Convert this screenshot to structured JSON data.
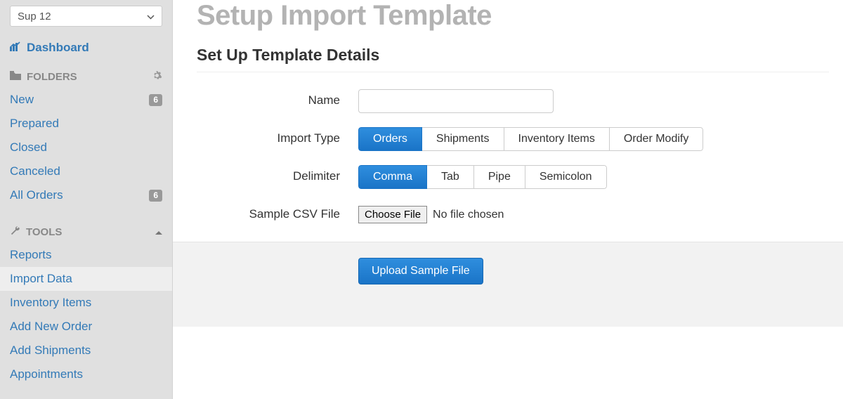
{
  "sidebar": {
    "selector": {
      "value": "Sup 12"
    },
    "dashboard": "Dashboard",
    "folders": {
      "label": "FOLDERS",
      "items": [
        {
          "label": "New",
          "badge": "6"
        },
        {
          "label": "Prepared"
        },
        {
          "label": "Closed"
        },
        {
          "label": "Canceled"
        },
        {
          "label": "All Orders",
          "badge": "6"
        }
      ]
    },
    "tools": {
      "label": "TOOLS",
      "items": [
        {
          "label": "Reports"
        },
        {
          "label": "Import Data",
          "active": true
        },
        {
          "label": "Inventory Items"
        },
        {
          "label": "Add New Order"
        },
        {
          "label": "Add Shipments"
        },
        {
          "label": "Appointments"
        }
      ]
    }
  },
  "main": {
    "title": "Setup Import Template",
    "section": "Set Up Template Details",
    "form": {
      "name": {
        "label": "Name",
        "value": ""
      },
      "import_type": {
        "label": "Import Type",
        "options": [
          "Orders",
          "Shipments",
          "Inventory Items",
          "Order Modify"
        ],
        "selected": "Orders"
      },
      "delimiter": {
        "label": "Delimiter",
        "options": [
          "Comma",
          "Tab",
          "Pipe",
          "Semicolon"
        ],
        "selected": "Comma"
      },
      "sample_file": {
        "label": "Sample CSV File",
        "button": "Choose File",
        "status": "No file chosen"
      },
      "submit": "Upload Sample File"
    }
  }
}
